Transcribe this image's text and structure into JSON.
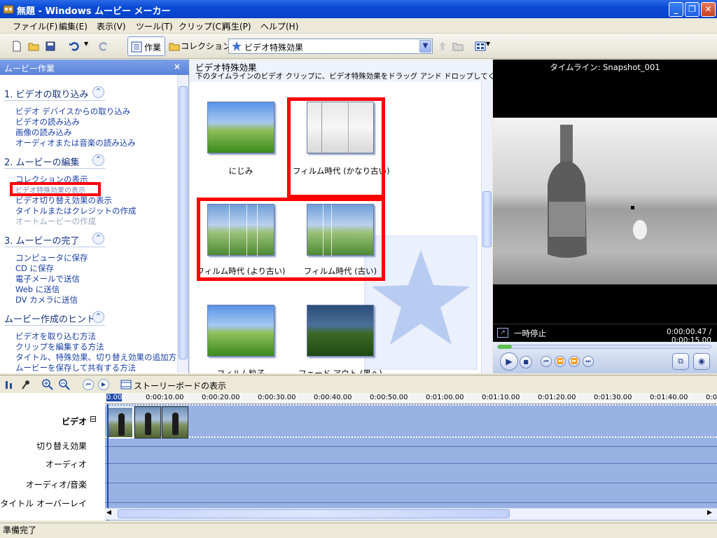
{
  "window": {
    "title": "無題 - Windows ムービー メーカー"
  },
  "menu": [
    "ファイル(F)",
    "編集(E)",
    "表示(V)",
    "ツール(T)",
    "クリップ(C)",
    "再生(P)",
    "ヘルプ(H)"
  ],
  "toolbar": {
    "tasks_label": "作業",
    "collections_label": "コレクション",
    "collection_select": "ビデオ特殊効果"
  },
  "taskpane": {
    "title": "ムービー作業",
    "close": "×",
    "sections": [
      {
        "title": "1. ビデオの取り込み",
        "links": [
          "ビデオ デバイスからの取り込み",
          "ビデオの読み込み",
          "画像の読み込み",
          "オーディオまたは音楽の読み込み"
        ]
      },
      {
        "title": "2. ムービーの編集",
        "links": [
          "コレクションの表示",
          "ビデオ特殊効果の表示",
          "ビデオ切り替え効果の表示",
          "タイトルまたはクレジットの作成",
          "オートムービーの作成"
        ]
      },
      {
        "title": "3. ムービーの完了",
        "links": [
          "コンピュータに保存",
          "CD に保存",
          "電子メールで送信",
          "Web に送信",
          "DV カメラに送信"
        ]
      },
      {
        "title": "ムービー作成のヒント",
        "links": [
          "ビデオを取り込む方法",
          "クリップを編集する方法",
          "タイトル、特殊効果、切り替え効果の追加方法",
          "ムービーを保存して共有する方法"
        ]
      }
    ],
    "collapse_glyph": "⌃"
  },
  "effects": {
    "title": "ビデオ特殊効果",
    "description": "下のタイムラインのビデオ クリップに、ビデオ特殊効果をドラッグ アンド ドロップしてください。",
    "items": [
      "にじみ",
      "フィルム時代 (かなり古い)",
      "フィルム時代 (より古い)",
      "フィルム時代 (古い)",
      "フィルム粒子",
      "フェード アウト (黒へ)"
    ]
  },
  "preview": {
    "title": "タイムライン: Snapshot_001",
    "state": "一時停止",
    "time": "0:00:00.47 / 0:00:15.00"
  },
  "timeline": {
    "storyboard_label": "ストーリーボードの表示",
    "tracks": {
      "video": "ビデオ",
      "transition": "切り替え効果",
      "audio": "オーディオ",
      "audio_music": "オーディオ/音楽",
      "title_overlay": "タイトル オーバーレイ"
    },
    "expand_glyph": "⊟",
    "ruler": [
      "0.00",
      "0:00:10.00",
      "0:00:20.00",
      "0:00:30.00",
      "0:00:40.00",
      "0:00:50.00",
      "0:01:00.00",
      "0:01:10.00",
      "0:01:20.00",
      "0:01:30.00",
      "0:01:40.00",
      "0:0"
    ]
  },
  "status": "準備完了",
  "colors": {
    "accent": "#0a4bd6",
    "highlight": "#ff0000",
    "timeline_track": "#98b2e4"
  }
}
